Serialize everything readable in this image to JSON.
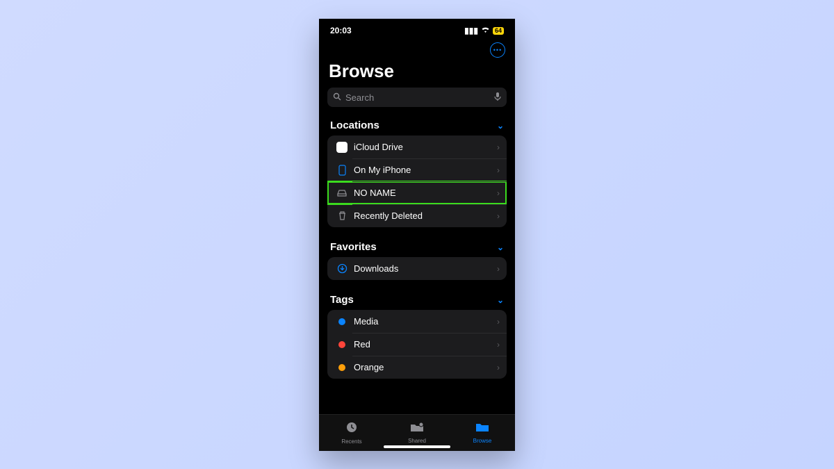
{
  "statusbar": {
    "time": "20:03",
    "battery": "64"
  },
  "title": "Browse",
  "search": {
    "placeholder": "Search"
  },
  "sections": {
    "locations": {
      "header": "Locations",
      "items": [
        {
          "label": "iCloud Drive"
        },
        {
          "label": "On My iPhone"
        },
        {
          "label": "NO NAME"
        },
        {
          "label": "Recently Deleted"
        }
      ]
    },
    "favorites": {
      "header": "Favorites",
      "items": [
        {
          "label": "Downloads"
        }
      ]
    },
    "tags": {
      "header": "Tags",
      "items": [
        {
          "label": "Media",
          "color": "#0a84ff"
        },
        {
          "label": "Red",
          "color": "#ff453a"
        },
        {
          "label": "Orange",
          "color": "#ff9f0a"
        }
      ]
    }
  },
  "tabs": {
    "recents": "Recents",
    "shared": "Shared",
    "browse": "Browse"
  }
}
